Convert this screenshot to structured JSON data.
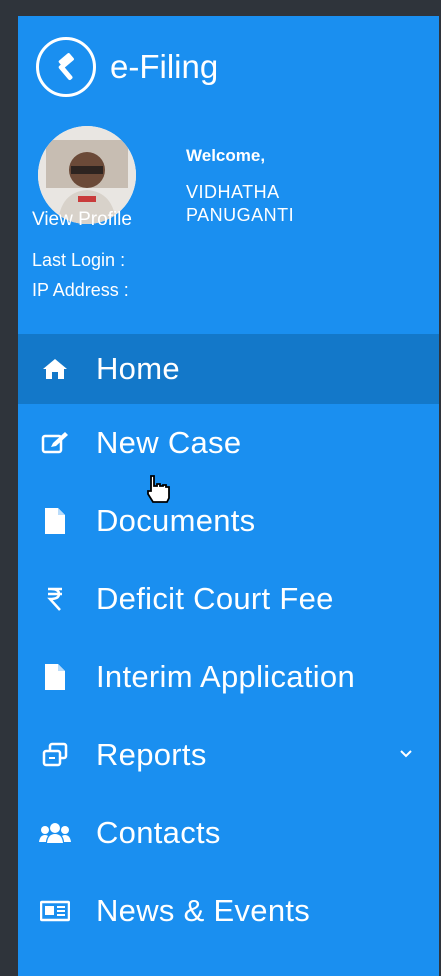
{
  "brand": {
    "title": "e-Filing",
    "logo_icon": "gavel-icon"
  },
  "profile": {
    "view_profile_label": "View Profile",
    "welcome": "Welcome,",
    "name_line1": "VIDHATHA",
    "name_line2": "PANUGANTI",
    "last_login_label": "Last Login :",
    "ip_address_label": "IP Address :"
  },
  "menu": {
    "items": [
      {
        "label": "Home",
        "icon": "home-icon",
        "active": true
      },
      {
        "label": "New Case",
        "icon": "edit-icon",
        "active": false
      },
      {
        "label": "Documents",
        "icon": "document-icon",
        "active": false
      },
      {
        "label": "Deficit Court Fee",
        "icon": "rupee-icon",
        "active": false
      },
      {
        "label": "Interim Application",
        "icon": "document-icon",
        "active": false
      },
      {
        "label": "Reports",
        "icon": "reports-icon",
        "active": false,
        "has_submenu": true
      },
      {
        "label": "Contacts",
        "icon": "contacts-icon",
        "active": false
      },
      {
        "label": "News & Events",
        "icon": "newspaper-icon",
        "active": false
      }
    ]
  },
  "colors": {
    "sidebar_bg": "#1a8ff0",
    "active_bg": "#1378c9",
    "frame_bg": "#2f343b",
    "text": "#ffffff"
  }
}
